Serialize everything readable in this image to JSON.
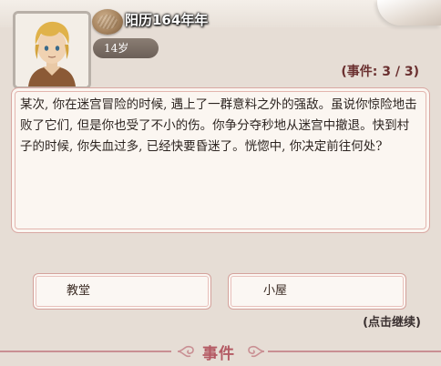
{
  "header": {
    "calendar_label": "阳历164年年",
    "age_label": "14岁",
    "event_counter": "(事件: 3 / 3)"
  },
  "event": {
    "text": "某次, 你在迷宫冒险的时候, 遇上了一群意料之外的强敌。虽说你惊险地击败了它们, 但是你也受了不小的伤。你争分夺秒地从迷宫中撤退。快到村子的时候, 你失血过多, 已经快要昏迷了。恍惚中, 你决定前往何处?"
  },
  "choices": [
    {
      "label": "教堂"
    },
    {
      "label": "小屋"
    }
  ],
  "continue_hint": "(点击继续)",
  "footer": {
    "title": "事件"
  },
  "colors": {
    "background": "#e6ddd5",
    "panel": "#fbf6f1",
    "border_pink": "#d9a8a3",
    "counter_text": "#6a2f2f",
    "footer_accent": "#b45a64"
  },
  "icons": {
    "currency": "coin-icon",
    "portrait": "character-portrait"
  }
}
